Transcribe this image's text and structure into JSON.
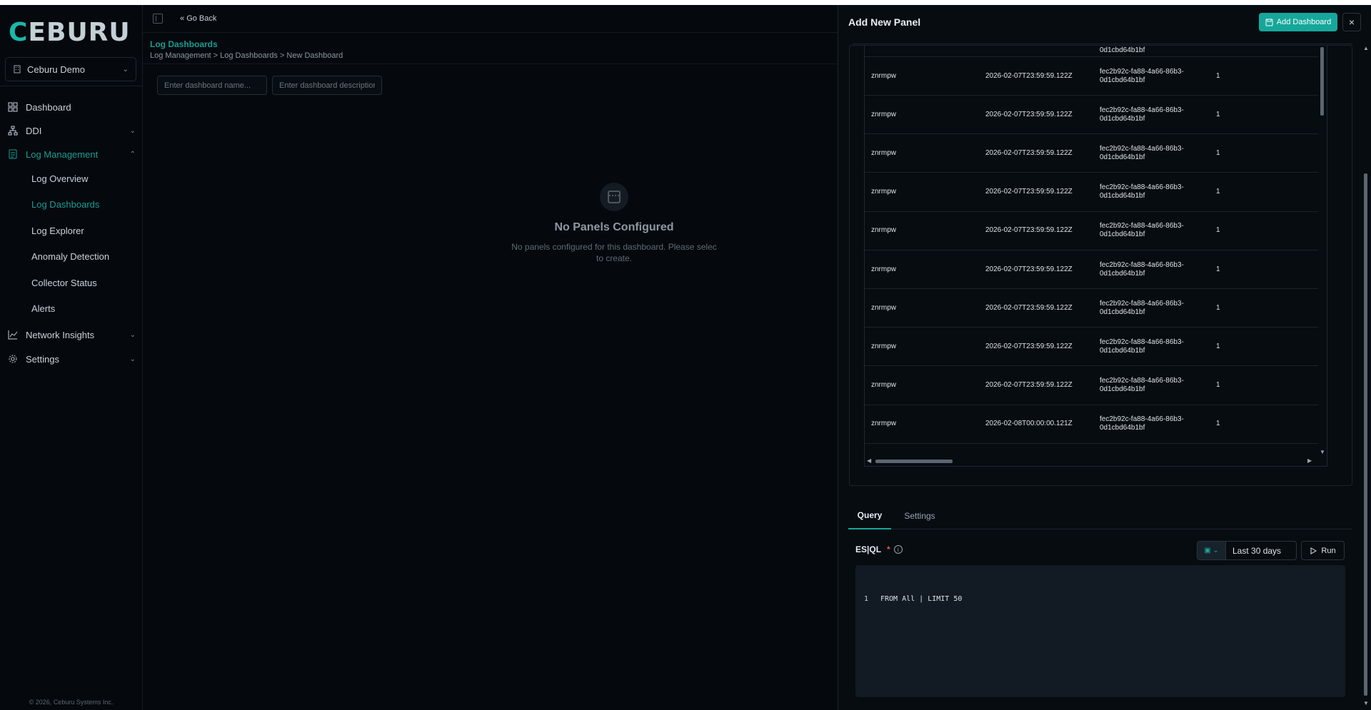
{
  "sidebar": {
    "logo": {
      "first": "C",
      "rest": "EBURU"
    },
    "org_selector": "Ceburu Demo",
    "nav": [
      {
        "label": "Dashboard"
      },
      {
        "label": "DDI"
      },
      {
        "label": "Log Management"
      }
    ],
    "sub_nav": [
      {
        "label": "Log Overview"
      },
      {
        "label": "Log Dashboards"
      },
      {
        "label": "Log Explorer"
      },
      {
        "label": "Anomaly Detection"
      },
      {
        "label": "Collector Status"
      },
      {
        "label": "Alerts"
      }
    ],
    "nav_bottom": [
      {
        "label": "Network Insights"
      },
      {
        "label": "Settings"
      }
    ],
    "footer": "© 2026, Ceburu Systems Inc."
  },
  "main": {
    "go_back": "Go Back",
    "page_title": "Log Dashboards",
    "breadcrumb": "Log Management > Log Dashboards > New Dashboard",
    "name_placeholder": "Enter dashboard name...",
    "description_placeholder": "Enter dashboard description",
    "empty_title": "No Panels Configured",
    "empty_desc_line1": "No panels configured for this dashboard. Please selec",
    "empty_desc_line2": "to create."
  },
  "drawer": {
    "title": "Add New Panel",
    "add_dashboard_label": "Add Dashboard",
    "close_label": "×",
    "partial_row_text": "0d1cbd64b1bf",
    "rows": [
      {
        "col1": "znrmpw",
        "col2": "2026-02-07T23:59:59.122Z",
        "col3_a": "fec2b92c-fa88-4a66-86b3-",
        "col3_b": "0d1cbd64b1bf",
        "col4": "1"
      },
      {
        "col1": "znrmpw",
        "col2": "2026-02-07T23:59:59.122Z",
        "col3_a": "fec2b92c-fa88-4a66-86b3-",
        "col3_b": "0d1cbd64b1bf",
        "col4": "1"
      },
      {
        "col1": "znrmpw",
        "col2": "2026-02-07T23:59:59.122Z",
        "col3_a": "fec2b92c-fa88-4a66-86b3-",
        "col3_b": "0d1cbd64b1bf",
        "col4": "1"
      },
      {
        "col1": "znrmpw",
        "col2": "2026-02-07T23:59:59.122Z",
        "col3_a": "fec2b92c-fa88-4a66-86b3-",
        "col3_b": "0d1cbd64b1bf",
        "col4": "1"
      },
      {
        "col1": "znrmpw",
        "col2": "2026-02-07T23:59:59.122Z",
        "col3_a": "fec2b92c-fa88-4a66-86b3-",
        "col3_b": "0d1cbd64b1bf",
        "col4": "1"
      },
      {
        "col1": "znrmpw",
        "col2": "2026-02-07T23:59:59.122Z",
        "col3_a": "fec2b92c-fa88-4a66-86b3-",
        "col3_b": "0d1cbd64b1bf",
        "col4": "1"
      },
      {
        "col1": "znrmpw",
        "col2": "2026-02-07T23:59:59.122Z",
        "col3_a": "fec2b92c-fa88-4a66-86b3-",
        "col3_b": "0d1cbd64b1bf",
        "col4": "1"
      },
      {
        "col1": "znrmpw",
        "col2": "2026-02-07T23:59:59.122Z",
        "col3_a": "fec2b92c-fa88-4a66-86b3-",
        "col3_b": "0d1cbd64b1bf",
        "col4": "1"
      },
      {
        "col1": "znrmpw",
        "col2": "2026-02-07T23:59:59.122Z",
        "col3_a": "fec2b92c-fa88-4a66-86b3-",
        "col3_b": "0d1cbd64b1bf",
        "col4": "1"
      },
      {
        "col1": "znrmpw",
        "col2": "2026-02-08T00:00:00.121Z",
        "col3_a": "fec2b92c-fa88-4a66-86b3-",
        "col3_b": "0d1cbd64b1bf",
        "col4": "1"
      }
    ],
    "tabs": [
      {
        "label": "Query"
      },
      {
        "label": "Settings"
      }
    ],
    "esql_label": "ES|QL",
    "required_mark": "*",
    "info_icon": "i",
    "time_range": "Last 30 days",
    "run_label": "Run",
    "editor_line_number": "1",
    "editor_code": "FROM All | LIMIT 50"
  },
  "icons": {
    "accent_color": "#16a79a",
    "list": [
      "building-icon",
      "grid-icon",
      "network-icon",
      "document-icon",
      "chart-icon",
      "gear-icon",
      "sidebar-toggle-icon",
      "double-chevron-left-icon",
      "save-icon",
      "close-icon",
      "calendar-icon",
      "play-icon",
      "info-icon"
    ]
  }
}
